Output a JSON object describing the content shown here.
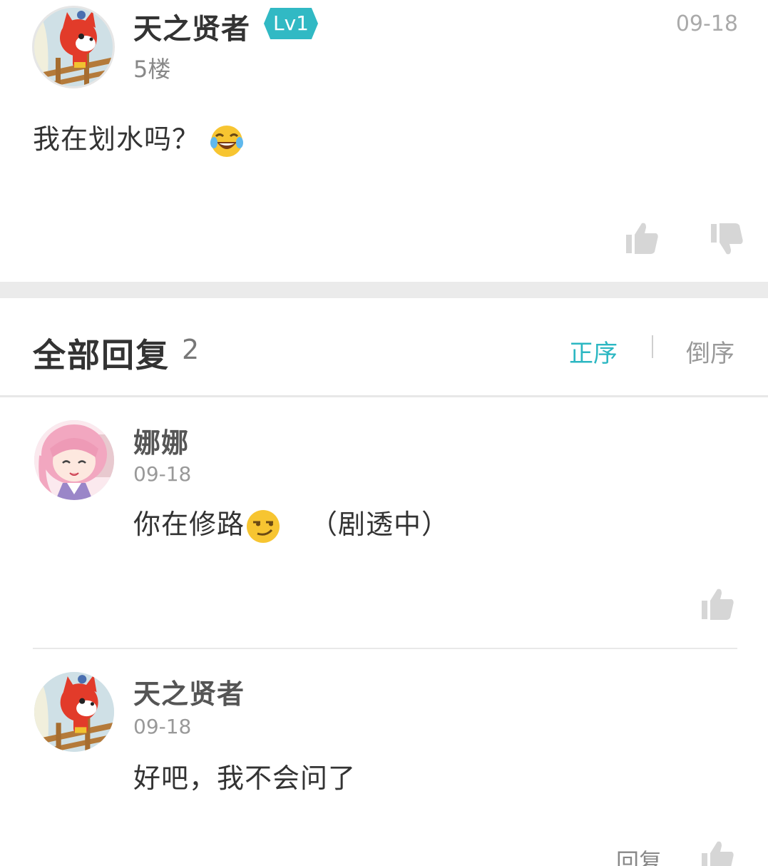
{
  "post": {
    "author": "天之贤者",
    "level_badge": "Lv1",
    "floor": "5楼",
    "date": "09-18",
    "content": "我在划水吗？",
    "content_emoji": "laugh-cry-emoji"
  },
  "replies_header": {
    "title": "全部回复",
    "count": "2",
    "sort_asc": "正序",
    "sort_desc": "倒序"
  },
  "replies": [
    {
      "author": "娜娜",
      "date": "09-18",
      "content_before": "你在修路",
      "content_emoji": "smirk-emoji",
      "content_after": "（剧透中）"
    },
    {
      "author": "天之贤者",
      "date": "09-18",
      "content": "好吧，我不会问了",
      "reply_label": "回复"
    }
  ],
  "colors": {
    "accent": "#2bb7c2",
    "level_badge": "#31b9c4",
    "divider": "#ebebeb",
    "icon_gray": "#d6d6d6"
  }
}
